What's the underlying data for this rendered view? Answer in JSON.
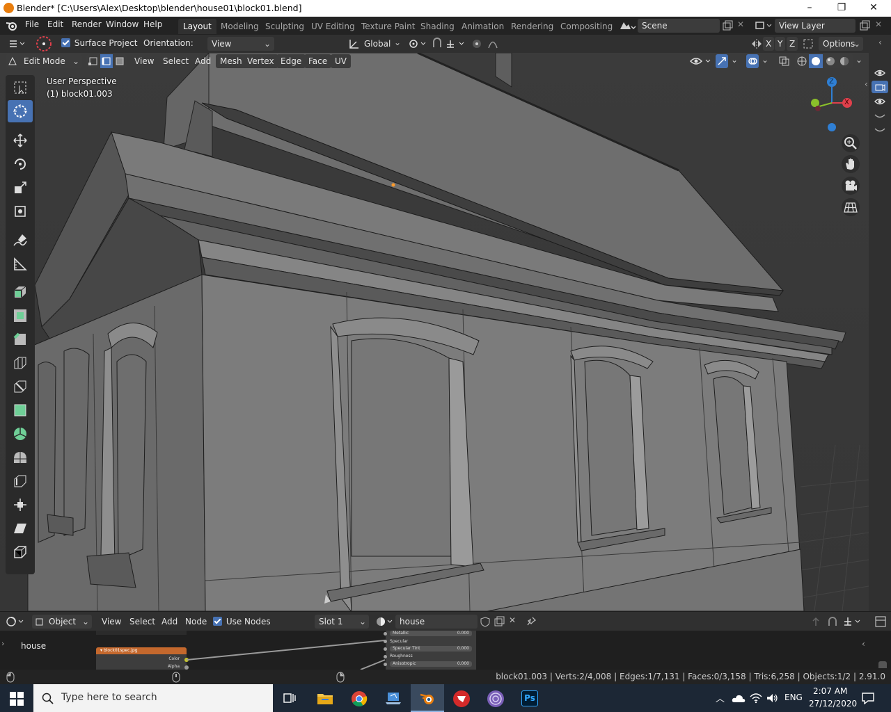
{
  "window": {
    "title": "Blender* [C:\\Users\\Alex\\Desktop\\blender\\house01\\block01.blend]",
    "controls": [
      "–",
      "❐",
      "✕"
    ]
  },
  "menubar": {
    "menus": [
      "File",
      "Edit",
      "Render",
      "Window",
      "Help"
    ],
    "workspaces": [
      "Layout",
      "Modeling",
      "Sculpting",
      "UV Editing",
      "Texture Paint",
      "Shading",
      "Animation",
      "Rendering",
      "Compositing"
    ],
    "active_workspace": "Layout",
    "scene": "Scene",
    "view_layer": "View Layer"
  },
  "tool_header": {
    "surface_project_label": "Surface Project",
    "surface_project_checked": true,
    "orientation_label": "Orientation:",
    "orientation_value": "View",
    "transform_orientation": "Global",
    "options_label": "Options",
    "axes": [
      "X",
      "Y",
      "Z"
    ]
  },
  "mode_header": {
    "mode": "Edit Mode",
    "menus": [
      "View",
      "Select",
      "Add",
      "Mesh",
      "Vertex",
      "Edge",
      "Face",
      "UV"
    ]
  },
  "viewport": {
    "view_name": "User Perspective",
    "object_name": "(1) block01.003",
    "gizmo": {
      "x": "X",
      "y": "Y",
      "z": "Z"
    },
    "colors": {
      "x_axis": "#e0404c",
      "y_axis": "#8bbf2a",
      "z_axis": "#2f7fd4",
      "background": "#3a3a3a",
      "accent": "#4772b3"
    }
  },
  "node_editor": {
    "editor_type": "Object",
    "menus": [
      "View",
      "Select",
      "Add",
      "Node"
    ],
    "use_nodes_label": "Use Nodes",
    "use_nodes_checked": true,
    "slot": "Slot 1",
    "material": "house",
    "sidebar_label": "house",
    "image_node_title": "block01spec.jpg",
    "image_node_outputs": [
      "Color",
      "Alpha"
    ],
    "bsdf_rows": [
      {
        "label": "Metallic",
        "value": "0.000"
      },
      {
        "label": "Specular",
        "value": ""
      },
      {
        "label": "Specular Tint",
        "value": "0.000"
      },
      {
        "label": "Roughness",
        "value": ""
      },
      {
        "label": "Anisotropic",
        "value": "0.000"
      }
    ]
  },
  "statusbar": {
    "stats": "block01.003 | Verts:2/4,008 | Edges:1/7,131 | Faces:0/3,158 | Tris:6,258 | Objects:1/2 | 2.91.0"
  },
  "taskbar": {
    "search_placeholder": "Type here to search",
    "language": "ENG",
    "time": "2:07 AM",
    "date": "27/12/2020",
    "apps": [
      "task-view",
      "file-explorer",
      "chrome",
      "laptop-app",
      "blender",
      "red-app",
      "purple-app",
      "photoshop"
    ],
    "ps_label": "Ps"
  }
}
